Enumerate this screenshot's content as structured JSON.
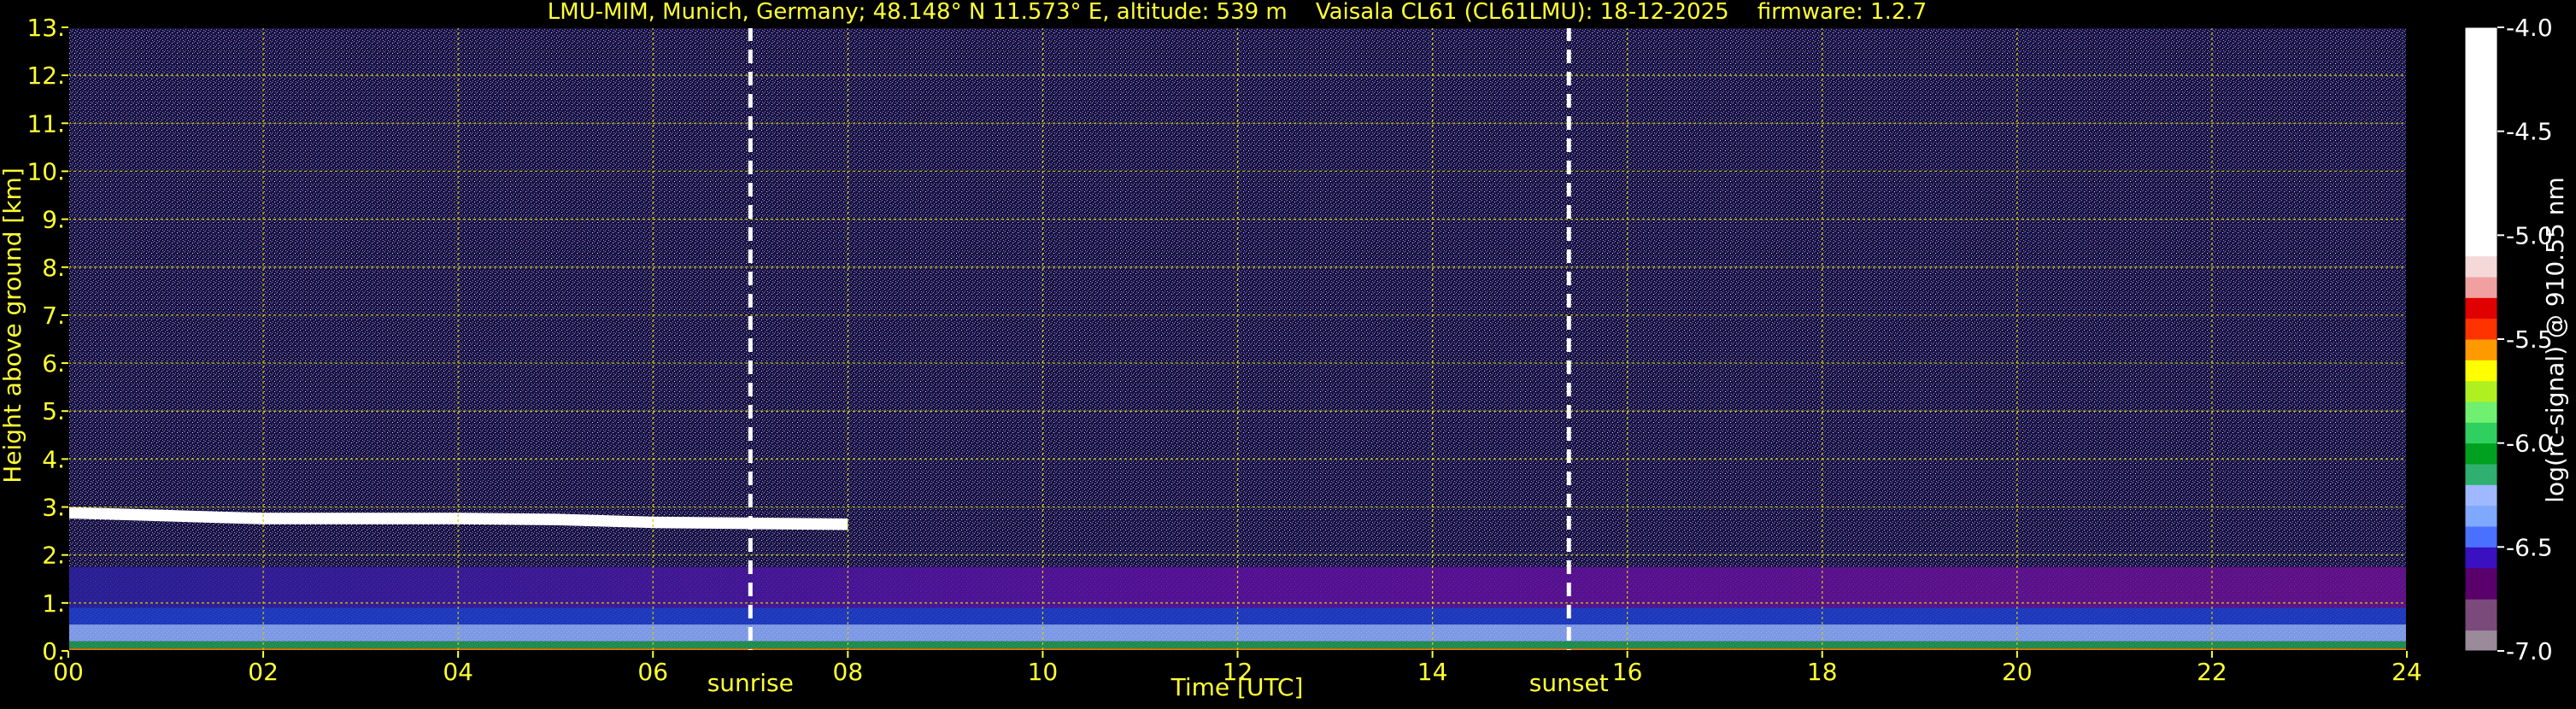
{
  "colors": {
    "background": "#000000",
    "text": "#ffff33",
    "cbar_text": "#ffffff",
    "grid": "#cccc00",
    "marker_line": "#ffffff"
  },
  "chart_data": {
    "type": "heatmap",
    "title": "LMU-MIM, Munich, Germany; 48.148° N 11.573° E, altitude: 539 m    Vaisala CL61 (CL61LMU): 18-12-2025    firmware: 1.2.7",
    "xlabel": "Time [UTC]",
    "ylabel": "Height above ground [km]",
    "xlim": [
      0,
      24
    ],
    "ylim": [
      0,
      13
    ],
    "x_ticks": [
      0,
      2,
      4,
      6,
      8,
      10,
      12,
      14,
      16,
      18,
      20,
      22,
      24
    ],
    "x_tick_labels": [
      "00",
      "02",
      "04",
      "06",
      "08",
      "10",
      "12",
      "14",
      "16",
      "18",
      "20",
      "22",
      "24"
    ],
    "y_ticks": [
      0,
      1,
      2,
      3,
      4,
      5,
      6,
      7,
      8,
      9,
      10,
      11,
      12,
      13
    ],
    "y_tick_labels": [
      "0.",
      "1.",
      "2.",
      "3.",
      "4.",
      "5.",
      "6.",
      "7.",
      "8.",
      "9.",
      "10.",
      "11.",
      "12.",
      "13."
    ],
    "grid": true,
    "markers": [
      {
        "label": "sunrise",
        "x": 7.0
      },
      {
        "label": "sunset",
        "x": 15.4
      }
    ],
    "colorbar": {
      "label": "log(rc-signal) @ 910.55 nm",
      "range": [
        -7.0,
        -4.0
      ],
      "ticks": [
        -7.0,
        -6.5,
        -6.0,
        -5.5,
        -5.0,
        -4.5,
        -4.0
      ],
      "tick_labels": [
        "-7.0",
        "-6.5",
        "-6.0",
        "-5.5",
        "-5.0",
        "-4.5",
        "-4.0"
      ],
      "stops": [
        {
          "v": -7.0,
          "c": "#9a8a9a"
        },
        {
          "v": -6.9,
          "c": "#7a4a7a"
        },
        {
          "v": -6.75,
          "c": "#5a006a"
        },
        {
          "v": -6.6,
          "c": "#3a10c0"
        },
        {
          "v": -6.5,
          "c": "#4a70ff"
        },
        {
          "v": -6.4,
          "c": "#7fa8ff"
        },
        {
          "v": -6.3,
          "c": "#9fb8ff"
        },
        {
          "v": -6.2,
          "c": "#30b070"
        },
        {
          "v": -6.1,
          "c": "#00a020"
        },
        {
          "v": -6.0,
          "c": "#30d060"
        },
        {
          "v": -5.9,
          "c": "#70f070"
        },
        {
          "v": -5.8,
          "c": "#b0f020"
        },
        {
          "v": -5.7,
          "c": "#ffff00"
        },
        {
          "v": -5.6,
          "c": "#ff9900"
        },
        {
          "v": -5.5,
          "c": "#ff3300"
        },
        {
          "v": -5.4,
          "c": "#e00000"
        },
        {
          "v": -5.3,
          "c": "#f0a0a0"
        },
        {
          "v": -5.2,
          "c": "#f5d8d8"
        },
        {
          "v": -5.1,
          "c": "#ffffff"
        },
        {
          "v": -4.0,
          "c": "#ffffff"
        }
      ]
    },
    "cloud_layer": {
      "points": [
        {
          "x": 0.0,
          "y": 2.88
        },
        {
          "x": 1.0,
          "y": 2.82
        },
        {
          "x": 2.0,
          "y": 2.76
        },
        {
          "x": 3.0,
          "y": 2.76
        },
        {
          "x": 4.0,
          "y": 2.76
        },
        {
          "x": 5.0,
          "y": 2.74
        },
        {
          "x": 6.0,
          "y": 2.68
        },
        {
          "x": 7.0,
          "y": 2.66
        },
        {
          "x": 8.0,
          "y": 2.64
        }
      ]
    }
  }
}
